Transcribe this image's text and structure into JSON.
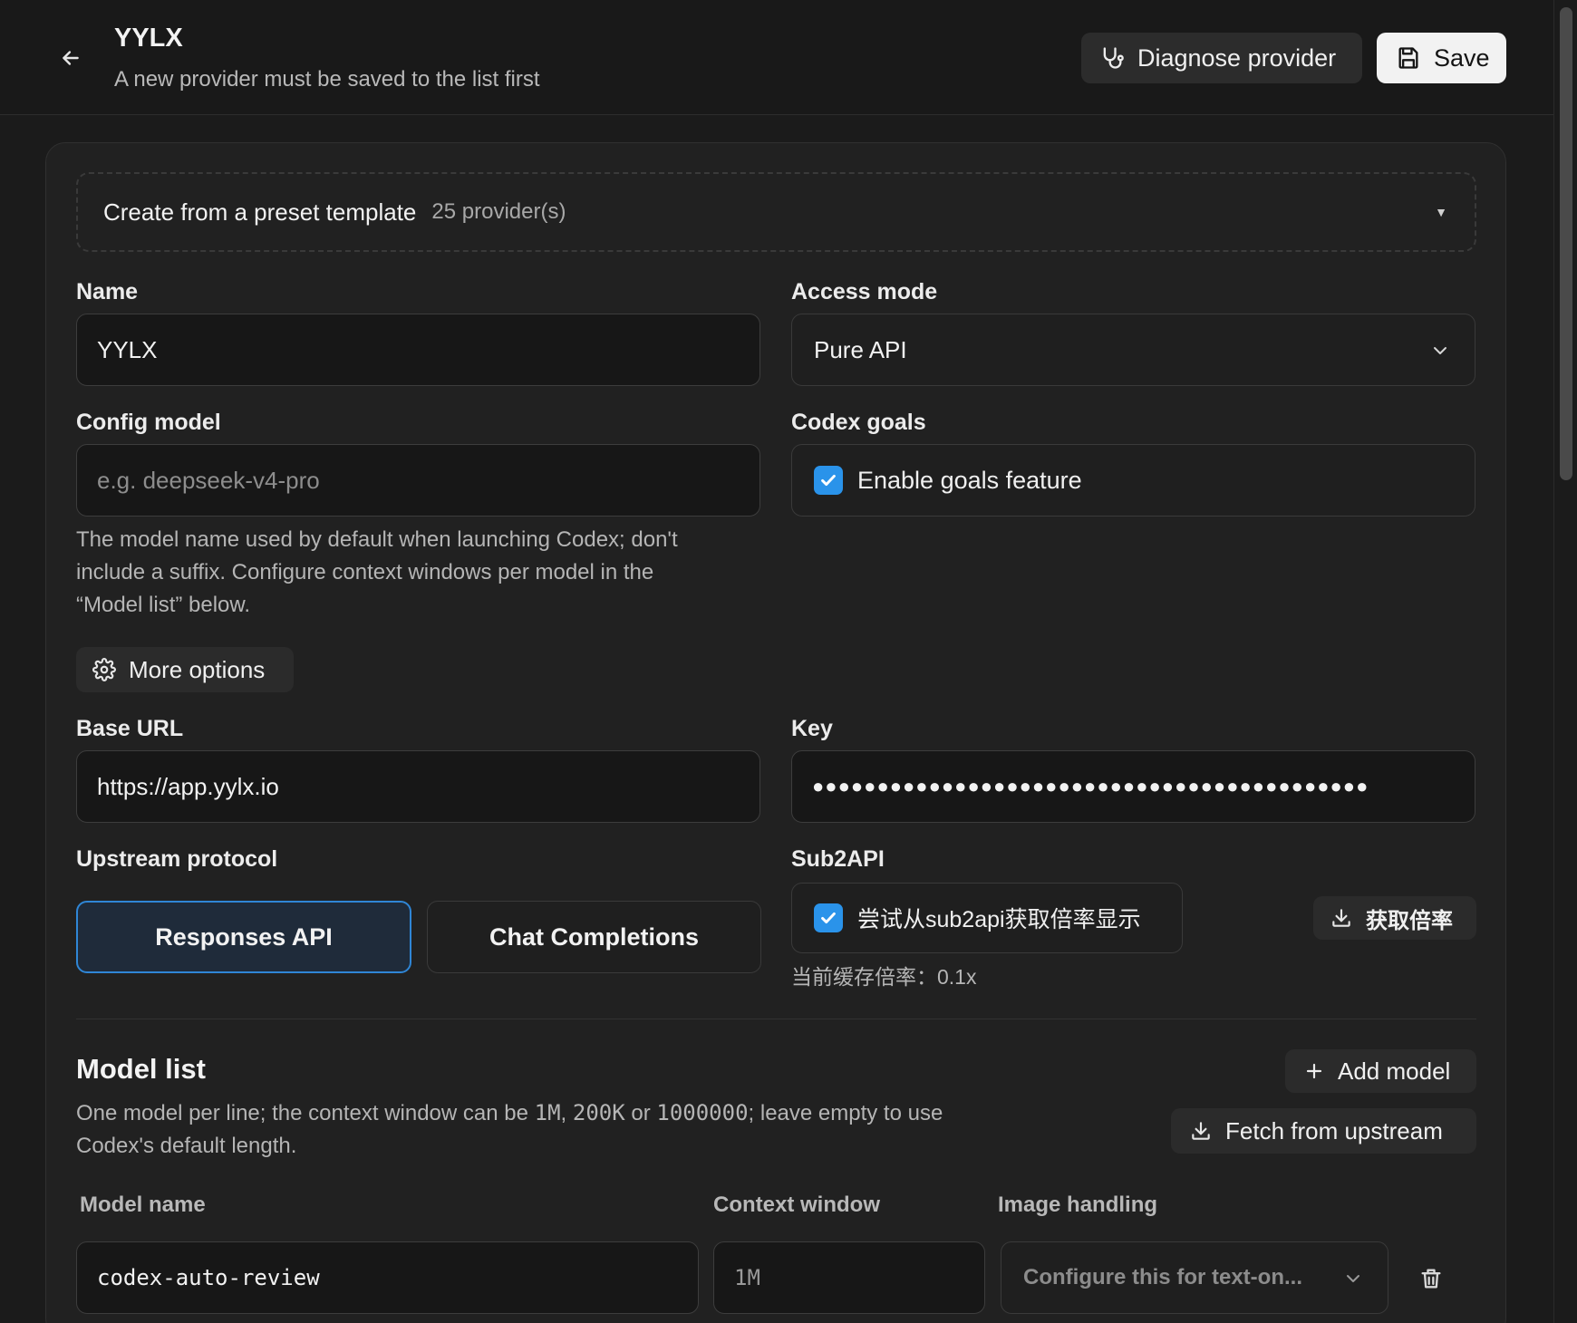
{
  "header": {
    "title": "YYLX",
    "subtitle": "A new provider must be saved to the list first",
    "diagnose_label": "Diagnose provider",
    "save_label": "Save"
  },
  "preset": {
    "label": "Create from a preset template",
    "count": "25 provider(s)"
  },
  "form": {
    "name_label": "Name",
    "name_value": "YYLX",
    "access_mode_label": "Access mode",
    "access_mode_value": "Pure API",
    "config_model_label": "Config model",
    "config_model_placeholder": "e.g. deepseek-v4-pro",
    "config_model_help_1": "The model name used by default when launching Codex; don't",
    "config_model_help_2": "include a suffix. Configure context windows per model in the",
    "config_model_help_3": "“Model list” below.",
    "codex_goals_label": "Codex goals",
    "goals_checkbox_label": "Enable goals feature",
    "goals_checked": true,
    "more_options_label": "More options",
    "base_url_label": "Base URL",
    "base_url_value": "https://app.yylx.io",
    "key_label": "Key",
    "key_masked": "●●●●●●●●●●●●●●●●●●●●●●●●●●●●●●●●●●●●●●●●●●●",
    "upstream_protocol_label": "Upstream protocol",
    "protocol_options": [
      "Responses API",
      "Chat Completions"
    ],
    "protocol_selected": "Responses API",
    "sub2api_label": "Sub2API",
    "sub2api_checkbox_label": "尝试从sub2api获取倍率显示",
    "sub2api_checked": true,
    "fetch_rate_label": "获取倍率",
    "cache_rate_text": "当前缓存倍率：0.1x"
  },
  "model_list": {
    "title": "Model list",
    "add_model_label": "Add model",
    "fetch_upstream_label": "Fetch from upstream",
    "description_parts": [
      "One model per line; the context window can be ",
      "1M",
      ", ",
      "200K",
      " or ",
      "1000000",
      "; leave empty to use"
    ],
    "description_line_2": "Codex's default length.",
    "columns": [
      "Model name",
      "Context window",
      "Image handling"
    ],
    "rows": [
      {
        "model_name": "codex-auto-review",
        "context_window": "1M",
        "image_handling": "Configure this for text-on..."
      }
    ]
  },
  "colors": {
    "accent": "#2a93ea",
    "background": "#1b1b1b",
    "card": "#212121"
  }
}
